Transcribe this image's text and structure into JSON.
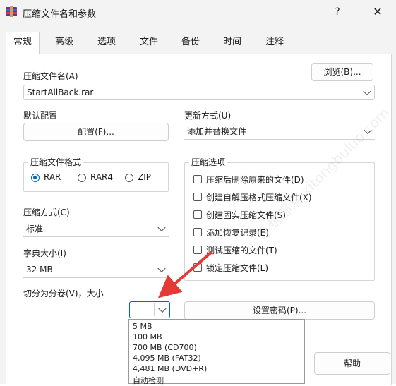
{
  "window": {
    "title": "压缩文件名和参数",
    "help_label": "?",
    "close_label": "✕"
  },
  "tabs": [
    {
      "label": "常规",
      "active": true
    },
    {
      "label": "高级",
      "active": false
    },
    {
      "label": "选项",
      "active": false
    },
    {
      "label": "文件",
      "active": false
    },
    {
      "label": "备份",
      "active": false
    },
    {
      "label": "时间",
      "active": false
    },
    {
      "label": "注释",
      "active": false
    }
  ],
  "archive": {
    "label": "压缩文件名(A)",
    "browse_label": "浏览(B)...",
    "filename": "StartAllBack.rar"
  },
  "profile": {
    "label": "默认配置",
    "button_label": "配置(F)..."
  },
  "update_mode": {
    "label": "更新方式(U)",
    "value": "添加并替换文件"
  },
  "format": {
    "label": "压缩文件格式",
    "options": [
      "RAR",
      "RAR4",
      "ZIP"
    ],
    "selected": "RAR"
  },
  "compression": {
    "label": "压缩方式(C)",
    "value": "标准"
  },
  "dictionary": {
    "label": "字典大小(I)",
    "value": "32 MB"
  },
  "split": {
    "label": "切分为分卷(V)，大小",
    "value": "",
    "options": [
      "5 MB",
      "100 MB",
      "700 MB  (CD700)",
      "4,095 MB  (FAT32)",
      "4,481 MB  (DVD+R)",
      "自动检测"
    ]
  },
  "archive_options": {
    "label": "压缩选项",
    "items": [
      {
        "label": "压缩后删除原来的文件(D)",
        "checked": false
      },
      {
        "label": "创建自解压格式压缩文件(X)",
        "checked": false
      },
      {
        "label": "创建固实压缩文件(S)",
        "checked": false
      },
      {
        "label": "添加恢复记录(E)",
        "checked": false
      },
      {
        "label": "测试压缩的文件(T)",
        "checked": false
      },
      {
        "label": "锁定压缩文件(L)",
        "checked": false
      }
    ]
  },
  "password_button_label": "设置密码(P)...",
  "help_button_label": "帮助",
  "accent_color": "#0067c0",
  "arrow_color": "#e53935",
  "watermark_text": "系统部落 xitongbuluo.com"
}
